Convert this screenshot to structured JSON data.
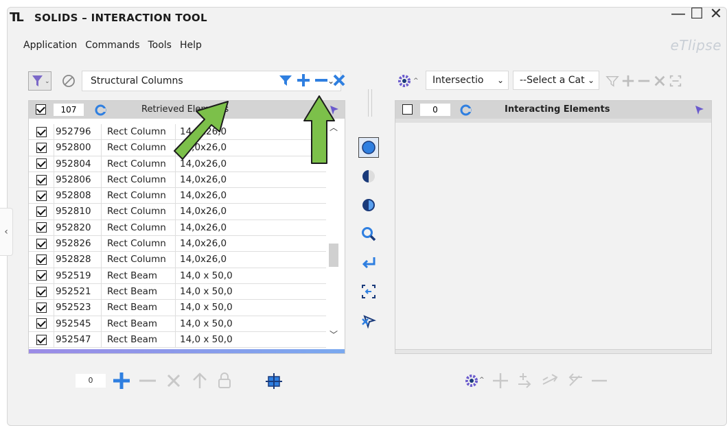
{
  "window": {
    "logo": "TL",
    "title": "SOLIDS – INTERACTION TOOL",
    "brand": "eTlipse",
    "controls": {
      "minimize": "—",
      "maximize": "☐",
      "close": "✕"
    }
  },
  "menu": [
    "Application",
    "Commands",
    "Tools",
    "Help"
  ],
  "left_toolbar": {
    "category": "Structural Columns",
    "icons": [
      "filter-icon",
      "plus-icon",
      "minus-icon",
      "close-icon"
    ]
  },
  "left_panel": {
    "count": "107",
    "title": "Retrieved Elements",
    "rows": [
      {
        "id": "952796",
        "type": "Rect Column",
        "size": "14,0x26,0"
      },
      {
        "id": "952800",
        "type": "Rect Column",
        "size": "14,0x26,0"
      },
      {
        "id": "952804",
        "type": "Rect Column",
        "size": "14,0x26,0"
      },
      {
        "id": "952806",
        "type": "Rect Column",
        "size": "14,0x26,0"
      },
      {
        "id": "952808",
        "type": "Rect Column",
        "size": "14,0x26,0"
      },
      {
        "id": "952810",
        "type": "Rect Column",
        "size": "14,0x26,0"
      },
      {
        "id": "952820",
        "type": "Rect Column",
        "size": "14,0x26,0"
      },
      {
        "id": "952826",
        "type": "Rect Column",
        "size": "14,0x26,0"
      },
      {
        "id": "952828",
        "type": "Rect Column",
        "size": "14,0x26,0"
      },
      {
        "id": "952519",
        "type": "Rect Beam",
        "size": "14,0 x 50,0"
      },
      {
        "id": "952521",
        "type": "Rect Beam",
        "size": "14,0 x 50,0"
      },
      {
        "id": "952523",
        "type": "Rect Beam",
        "size": "14,0 x 50,0"
      },
      {
        "id": "952545",
        "type": "Rect Beam",
        "size": "14,0 x 50,0"
      },
      {
        "id": "952547",
        "type": "Rect Beam",
        "size": "14,0 x 50,0"
      }
    ]
  },
  "right_toolbar": {
    "mode": "Intersectio",
    "category": "--Select a Categ"
  },
  "right_panel": {
    "count": "0",
    "title": "Interacting Elements"
  },
  "bottom_left": {
    "count": "0"
  },
  "colors": {
    "accent_blue": "#2f7fe0",
    "arrow_green": "#7cc04a",
    "icon_gray": "#c8c8c8"
  }
}
